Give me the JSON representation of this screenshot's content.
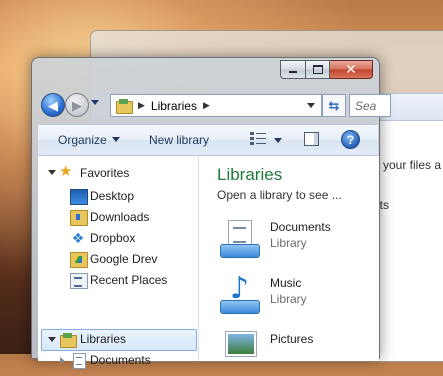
{
  "background_window": {
    "text_line1": "e your files a",
    "text_line2": "nts"
  },
  "window": {
    "controls": {
      "minimize": "minimize",
      "maximize": "maximize",
      "close": "✕"
    }
  },
  "nav": {
    "back_glyph": "◀",
    "forward_glyph": "▶",
    "refresh_glyph": "⇆"
  },
  "address": {
    "path": [
      "Libraries"
    ]
  },
  "search": {
    "placeholder": "Sea"
  },
  "toolbar": {
    "organize": "Organize",
    "new_library": "New library",
    "help": "?"
  },
  "navpane": {
    "favorites": {
      "label": "Favorites",
      "items": [
        "Desktop",
        "Downloads",
        "Dropbox",
        "Google Drev",
        "Recent Places"
      ]
    },
    "libraries": {
      "label": "Libraries",
      "children": [
        "Documents"
      ]
    }
  },
  "content": {
    "title": "Libraries",
    "subtitle": "Open a library to see ...",
    "libraries": [
      {
        "name": "Documents",
        "type": "Library",
        "icon": "documents-library-icon"
      },
      {
        "name": "Music",
        "type": "Library",
        "icon": "music-library-icon"
      },
      {
        "name": "Pictures",
        "type": "",
        "icon": "pictures-library-icon"
      }
    ]
  },
  "colors": {
    "title_green": "#1e7a3c",
    "selection_blue": "#d6e8fb",
    "toolbar_text": "#1e395b"
  }
}
